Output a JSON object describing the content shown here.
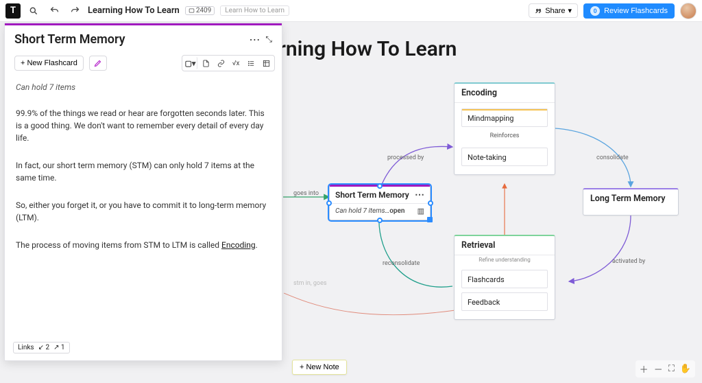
{
  "topbar": {
    "logo_letter": "T",
    "title": "Learning How To Learn",
    "badge": "2409",
    "chip": "Learn How to Learn",
    "share_label": "Share",
    "review_label": "Review Flashcards",
    "review_count": "0"
  },
  "panel": {
    "title": "Short Term Memory",
    "new_flashcard": "+ New Flashcard",
    "lead": "Can hold 7 items",
    "p1": "99.9% of the things we read or hear are forgotten seconds later. This is a good thing. We don't want to remember every detail of every day life.",
    "p2": "In fact, our short term memory (STM) can only hold 7 items at the same time.",
    "p3": "So, either you forget it, or you have to commit it to long-term memory (LTM).",
    "p4_pre": "The process of moving items from STM to LTM is called ",
    "p4_link": "Encoding",
    "links_label": "Links",
    "links_in": "↙ 2",
    "links_out": "↗ 1"
  },
  "canvas": {
    "title": "Learning How To Learn",
    "new_note": "+ New Note",
    "edges": {
      "processed_by": "processed by",
      "goes_into": "goes into",
      "reconsolidate": "reconsolidate",
      "consolidate": "consolidate",
      "activated_by": "activated by",
      "reinforces": "Reinforces",
      "refine": "Refine understanding",
      "stm_in_left": "stm in, goes"
    },
    "nodes": {
      "encoding": {
        "title": "Encoding",
        "sub1": "Mindmapping",
        "sub2": "Note-taking"
      },
      "retrieval": {
        "title": "Retrieval",
        "sub1": "Flashcards",
        "sub2": "Feedback"
      },
      "ltm": {
        "title": "Long Term Memory"
      },
      "stm": {
        "title": "Short Term Memory",
        "body_pre": "Can hold 7 items…",
        "body_open": "open"
      }
    }
  }
}
